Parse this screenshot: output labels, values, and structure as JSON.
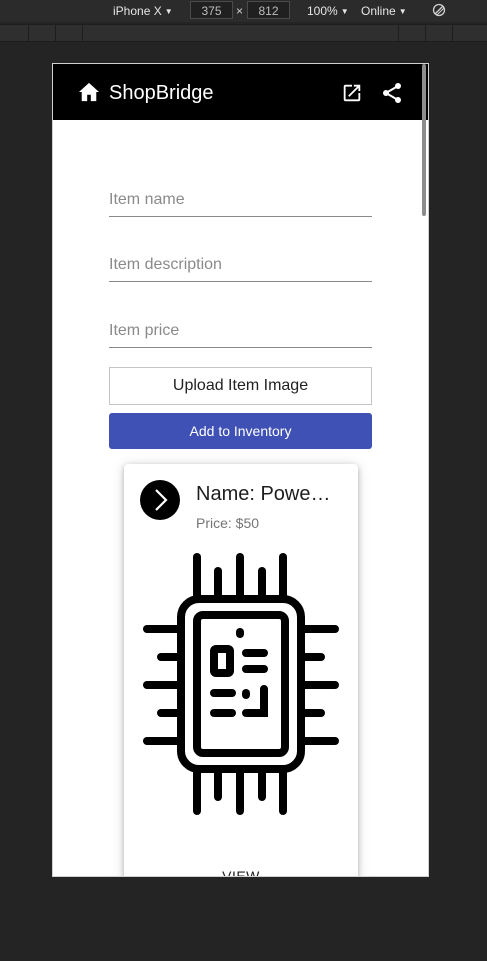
{
  "devtools": {
    "device": "iPhone X",
    "width": "375",
    "times": "×",
    "height": "812",
    "zoom": "100%",
    "network": "Online",
    "rotate_icon": "rotate-icon"
  },
  "appbar": {
    "title": "ShopBridge",
    "home_icon": "home-icon",
    "open_icon": "open-in-new-icon",
    "share_icon": "share-icon"
  },
  "form": {
    "name_placeholder": "Item name",
    "name_value": "",
    "description_placeholder": "Item description",
    "description_value": "",
    "price_placeholder": "Item price",
    "price_value": "",
    "upload_label": "Upload Item Image",
    "add_label": "Add to Inventory"
  },
  "card": {
    "name": "Name: Powe…",
    "price": "Price: $50",
    "avatar_icon": "chevron-right-icon",
    "image_icon": "microchip-icon",
    "action_label": "VIEW"
  },
  "colors": {
    "appbar_bg": "#000000",
    "primary_button": "#3f51b5",
    "devtools_bg": "#242424"
  }
}
